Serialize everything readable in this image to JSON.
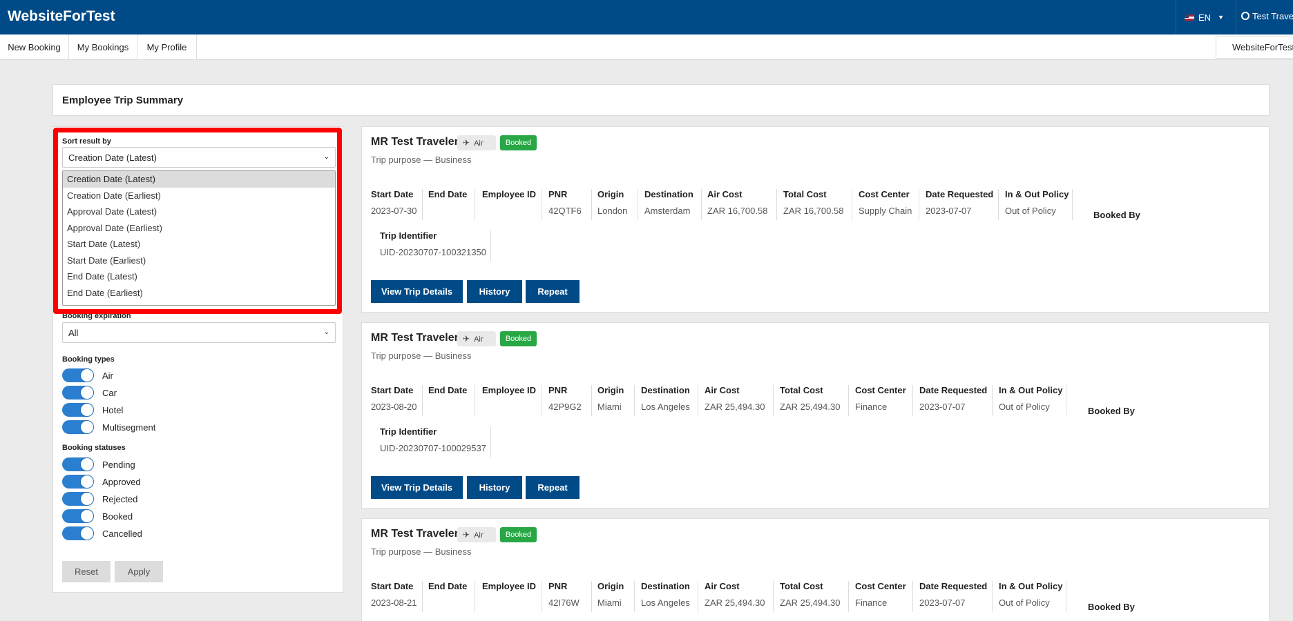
{
  "header": {
    "brand": "WebsiteForTest",
    "language": "EN",
    "user": "Test Traveler"
  },
  "subnav": {
    "items": [
      "New Booking",
      "My Bookings",
      "My Profile"
    ],
    "right_label": "WebsiteForTest"
  },
  "page_title": "Employee Trip Summary",
  "filters": {
    "sort_label": "Sort result by",
    "sort_value": "Creation Date (Latest)",
    "sort_options": [
      "Creation Date (Latest)",
      "Creation Date (Earliest)",
      "Approval Date (Latest)",
      "Approval Date (Earliest)",
      "Start Date (Latest)",
      "Start Date (Earliest)",
      "End Date (Latest)",
      "End Date (Earliest)"
    ],
    "expiration_label": "Booking expiration",
    "expiration_value": "All",
    "types_label": "Booking types",
    "types": [
      {
        "label": "Air",
        "on": true
      },
      {
        "label": "Car",
        "on": true
      },
      {
        "label": "Hotel",
        "on": true
      },
      {
        "label": "Multisegment",
        "on": true
      }
    ],
    "statuses_label": "Booking statuses",
    "statuses": [
      {
        "label": "Pending",
        "on": true
      },
      {
        "label": "Approved",
        "on": true
      },
      {
        "label": "Rejected",
        "on": true
      },
      {
        "label": "Booked",
        "on": true
      },
      {
        "label": "Cancelled",
        "on": true
      }
    ],
    "reset_label": "Reset",
    "apply_label": "Apply"
  },
  "column_headers": {
    "start_date": "Start Date",
    "end_date": "End Date",
    "employee_id": "Employee ID",
    "pnr": "PNR",
    "origin": "Origin",
    "destination": "Destination",
    "air_cost": "Air Cost",
    "total_cost": "Total Cost",
    "cost_center": "Cost Center",
    "date_requested": "Date Requested",
    "policy": "In & Out Policy",
    "booked_by": "Booked By",
    "trip_identifier": "Trip Identifier"
  },
  "card_buttons": {
    "details": "View Trip Details",
    "history": "History",
    "repeat": "Repeat"
  },
  "trips": [
    {
      "traveler": "MR Test Traveler",
      "type": "Air",
      "status": "Booked",
      "purpose": "Trip purpose — Business",
      "start_date": "2023-07-30",
      "end_date": "",
      "employee_id": "",
      "pnr": "42QTF6",
      "origin": "London",
      "destination": "Amsterdam",
      "air_cost": "ZAR 16,700.58",
      "total_cost": "ZAR 16,700.58",
      "cost_center": "Supply Chain",
      "date_requested": "2023-07-07",
      "policy": "Out of Policy",
      "trip_identifier": "UID-20230707-100321350"
    },
    {
      "traveler": "MR Test Traveler",
      "type": "Air",
      "status": "Booked",
      "purpose": "Trip purpose — Business",
      "start_date": "2023-08-20",
      "end_date": "",
      "employee_id": "",
      "pnr": "42P9G2",
      "origin": "Miami",
      "destination": "Los Angeles",
      "air_cost": "ZAR 25,494.30",
      "total_cost": "ZAR 25,494.30",
      "cost_center": "Finance",
      "date_requested": "2023-07-07",
      "policy": "Out of Policy",
      "trip_identifier": "UID-20230707-100029537"
    },
    {
      "traveler": "MR Test Traveler",
      "type": "Air",
      "status": "Booked",
      "purpose": "Trip purpose — Business",
      "start_date": "2023-08-21",
      "end_date": "",
      "employee_id": "",
      "pnr": "42I76W",
      "origin": "Miami",
      "destination": "Los Angeles",
      "air_cost": "ZAR 25,494.30",
      "total_cost": "ZAR 25,494.30",
      "cost_center": "Finance",
      "date_requested": "2023-07-07",
      "policy": "Out of Policy",
      "trip_identifier": ""
    }
  ],
  "colors": {
    "brand_blue": "#004b87",
    "toggle_blue": "#2b7fd0",
    "booked_green": "#28a745",
    "highlight_red": "#ff0000"
  }
}
